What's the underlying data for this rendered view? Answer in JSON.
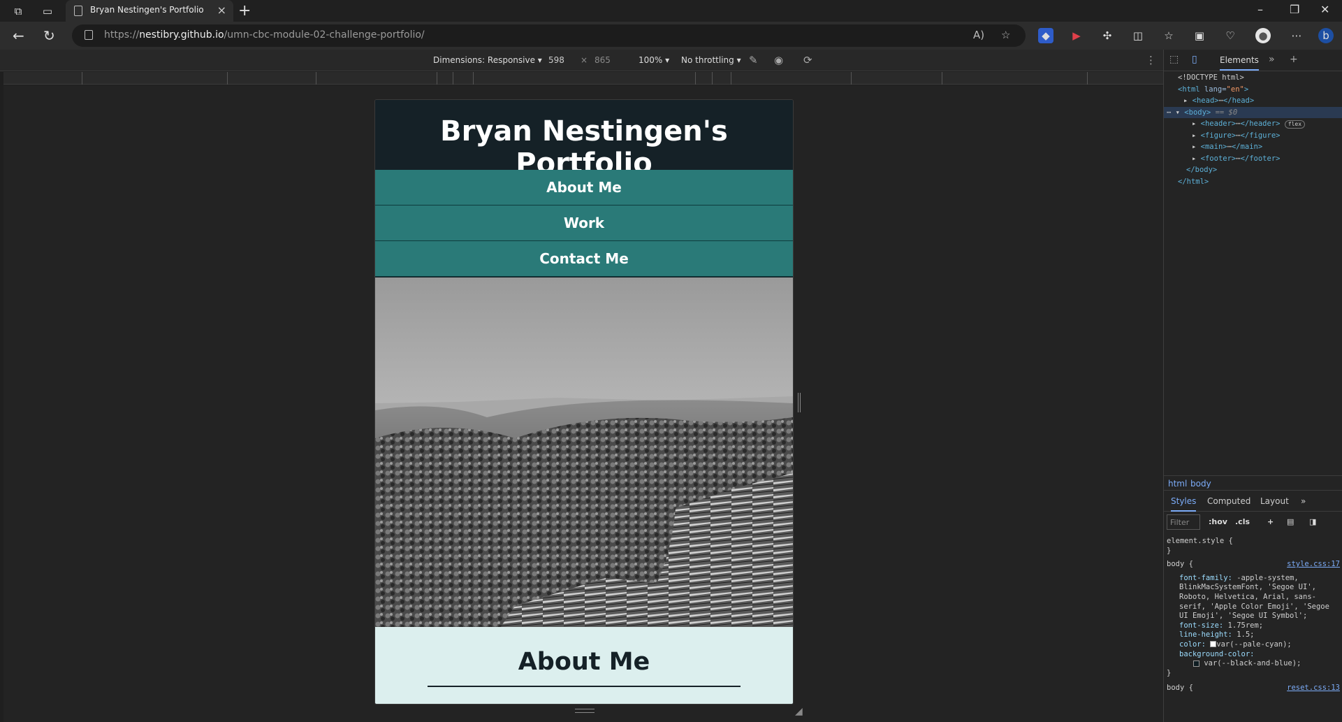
{
  "browser": {
    "tab_title": "Bryan Nestingen's Portfolio",
    "url_prefix": "https://",
    "url_domain": "nestibry.github.io",
    "url_path": "/umn-cbc-module-02-challenge-portfolio/"
  },
  "device_toolbar": {
    "dimensions_label": "Dimensions: Responsive",
    "width": "598",
    "times": "×",
    "height": "865",
    "zoom": "100%",
    "throttling": "No throttling"
  },
  "page": {
    "title": "Bryan Nestingen's Portfolio",
    "nav": [
      "About Me",
      "Work",
      "Contact Me"
    ],
    "about_heading": "About Me"
  },
  "devtools": {
    "tab_elements": "Elements",
    "dom": {
      "doctype": "<!DOCTYPE html>",
      "html_open_tag": "<html",
      "html_attr": " lang=",
      "html_attr_value": "\"en\"",
      "html_open_close": ">",
      "head": "<head>",
      "head_close": "</head>",
      "body_open": "<body>",
      "body_eq": "== $0",
      "header": "<header>",
      "header_close": "</header>",
      "flex_badge": "flex",
      "figure": "<figure>",
      "figure_close": "</figure>",
      "main": "<main>",
      "main_close": "</main>",
      "footer": "<footer>",
      "footer_close": "</footer>",
      "body_close": "</body>",
      "html_close": "</html>",
      "ellipsis": "⋯"
    },
    "breadcrumbs": [
      "html",
      "body"
    ],
    "subtabs": [
      "Styles",
      "Computed",
      "Layout"
    ],
    "filter_placeholder": "Filter",
    "hov": ":hov",
    "cls": ".cls",
    "styles": {
      "element_style": "element.style {",
      "close_brace": "}",
      "body_selector": "body {",
      "body_source": "style.css:17",
      "font_family_prop": "font-family:",
      "font_family_val": "-apple-system, BlinkMacSystemFont, 'Segoe UI', Roboto, Helvetica, Arial, sans-serif, 'Apple Color Emoji', 'Segoe UI Emoji', 'Segoe UI Symbol';",
      "font_size_prop": "font-size:",
      "font_size_val": "1.75rem;",
      "line_height_prop": "line-height:",
      "line_height_val": "1.5;",
      "color_prop": "color:",
      "color_val": "var(--pale-cyan);",
      "bg_prop": "background-color:",
      "bg_val": "var(--black-and-blue);",
      "body2_selector": "body {",
      "body2_source": "reset.css:13"
    }
  },
  "colors": {
    "header_bg": "#152127",
    "nav_bg": "#2a7a78",
    "about_bg": "#dcefee",
    "pale_cyan": "#ffffff"
  },
  "icons": [
    "workspaces-icon",
    "tab-actions-icon",
    "page-icon",
    "close-icon",
    "plus-icon",
    "minimize-icon",
    "restore-icon",
    "back-icon",
    "refresh-icon",
    "lock-icon",
    "read-aloud-icon",
    "favorite-star-icon",
    "extensions-icon",
    "split-screen-icon",
    "favorites-icon",
    "collections-icon",
    "profile-icon",
    "more-icon",
    "copilot-icon"
  ]
}
